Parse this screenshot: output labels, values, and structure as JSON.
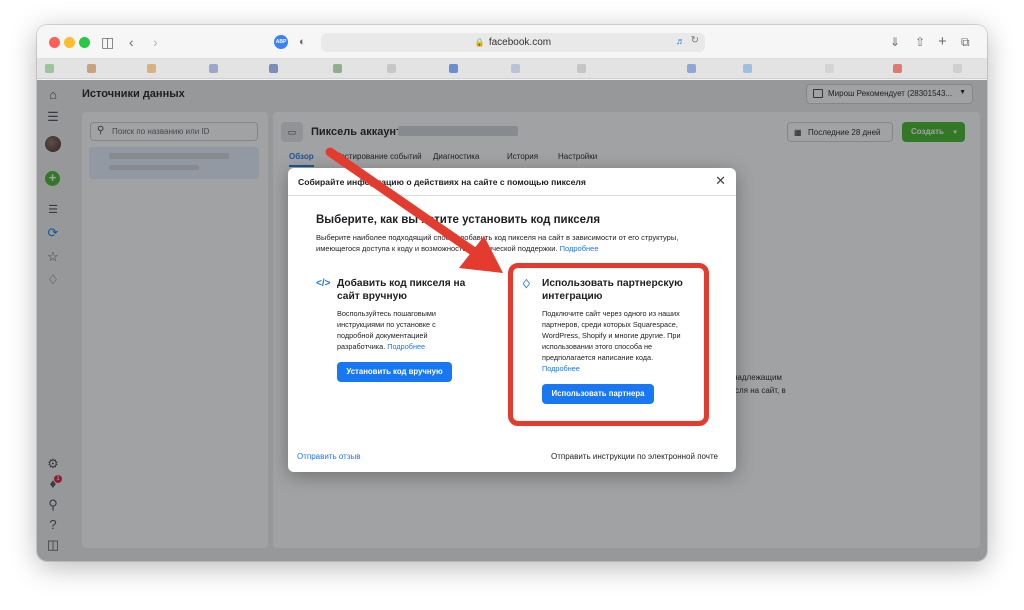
{
  "browser": {
    "url": "facebook.com",
    "abp_label": "ABP"
  },
  "page": {
    "title": "Источники данных",
    "account_name": "Мирош Рекомендует (28301543...",
    "search_placeholder": "Поиск по названию или ID",
    "pixel_title": "Пиксель аккаунта",
    "date_range": "Последние 28 дней",
    "create_button": "Создать",
    "tabs": [
      "Обзор",
      "Тестирование событий",
      "Диагностика",
      "История",
      "Настройки"
    ],
    "right_snippet_1": "надлежащим",
    "right_snippet_2": "сля на сайт, в",
    "notification_count": "1"
  },
  "modal": {
    "header": "Собирайте информацию о действиях на сайте с помощью пикселя",
    "heading": "Выберите, как вы хотите установить код пикселя",
    "description": "Выберите наиболее подходящий способ добавить код пикселя на сайт в зависимости от его структуры, имеющегося доступа к коду и возможностей технической поддержки.",
    "more_link": "Подробнее",
    "option_manual": {
      "title": "Добавить код пикселя на сайт вручную",
      "body": "Воспользуйтесь пошаговыми инструкциями по установке с подробной документацией разработчика.",
      "link": "Подробнее",
      "button": "Установить код вручную"
    },
    "option_partner": {
      "title": "Использовать партнерскую интеграцию",
      "body": "Подключите сайт через одного из наших партнеров, среди которых Squarespace, WordPress, Shopify и многие другие. При использовании этого способа не предполагается написание кода.",
      "link": "Подробнее",
      "button": "Использовать партнера"
    },
    "footer_left": "Отправить отзыв",
    "footer_right": "Отправить инструкции по электронной почте"
  },
  "colors": {
    "fb_blue": "#1877f2",
    "annotation_red": "#e33b2e",
    "create_green": "#42b72a"
  }
}
